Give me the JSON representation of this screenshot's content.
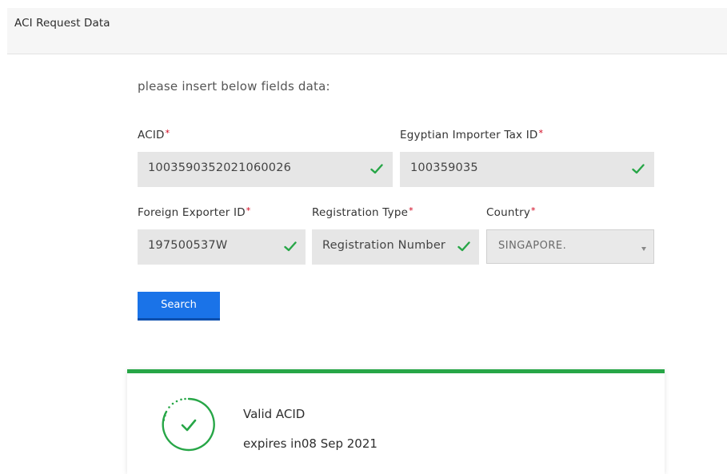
{
  "header": {
    "title": "ACI Request Data"
  },
  "form": {
    "instruction": "please insert below fields data:",
    "required_marker": "*",
    "fields": {
      "acid": {
        "label": "ACID",
        "value": "1003590352021060026",
        "valid": true
      },
      "importer_tax_id": {
        "label": "Egyptian Importer Tax ID",
        "value": "100359035",
        "valid": true
      },
      "foreign_exporter_id": {
        "label": "Foreign Exporter ID",
        "value": "197500537W",
        "valid": true
      },
      "registration_type": {
        "label": "Registration Type",
        "value": "Registration Number",
        "valid": true
      },
      "country": {
        "label": "Country",
        "selected": "SINGAPORE."
      }
    },
    "search_label": "Search"
  },
  "result": {
    "status": "Valid ACID",
    "expiry_text": "expires in08 Sep 2021",
    "icon": "check-circle-icon"
  },
  "colors": {
    "accent_blue": "#1a73e8",
    "valid_green": "#27a647",
    "required_red": "#d0021b",
    "input_bg": "#e6e6e6"
  }
}
